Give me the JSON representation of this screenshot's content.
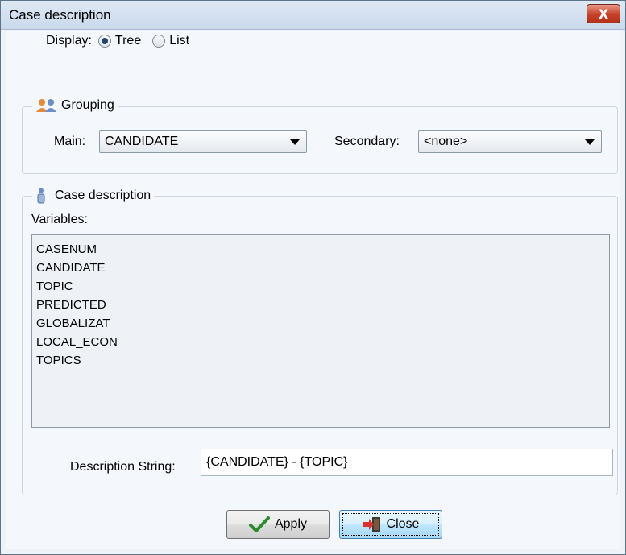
{
  "window": {
    "title": "Case description",
    "close_glyph": "X"
  },
  "display": {
    "label": "Display:",
    "options": [
      {
        "label": "Tree",
        "selected": true
      },
      {
        "label": "List",
        "selected": false
      }
    ]
  },
  "grouping": {
    "legend": "Grouping",
    "icon": "people-icon",
    "main_label": "Main:",
    "main_value": "CANDIDATE",
    "secondary_label": "Secondary:",
    "secondary_value": "<none>"
  },
  "case_description": {
    "legend": "Case description",
    "icon": "person-icon",
    "variables_label": "Variables:",
    "variables": [
      "CASENUM",
      "CANDIDATE",
      "TOPIC",
      "PREDICTED",
      "GLOBALIZAT",
      "LOCAL_ECON",
      "TOPICS"
    ],
    "description_label": "Description String:",
    "description_value": "{CANDIDATE} - {TOPIC}"
  },
  "buttons": {
    "apply_label": "Apply",
    "close_label": "Close"
  },
  "colors": {
    "titlebar": "#c9d9ec",
    "close_button": "#c6402a",
    "checkmark": "#2e8b2e",
    "close_icon": "#d9342b"
  }
}
